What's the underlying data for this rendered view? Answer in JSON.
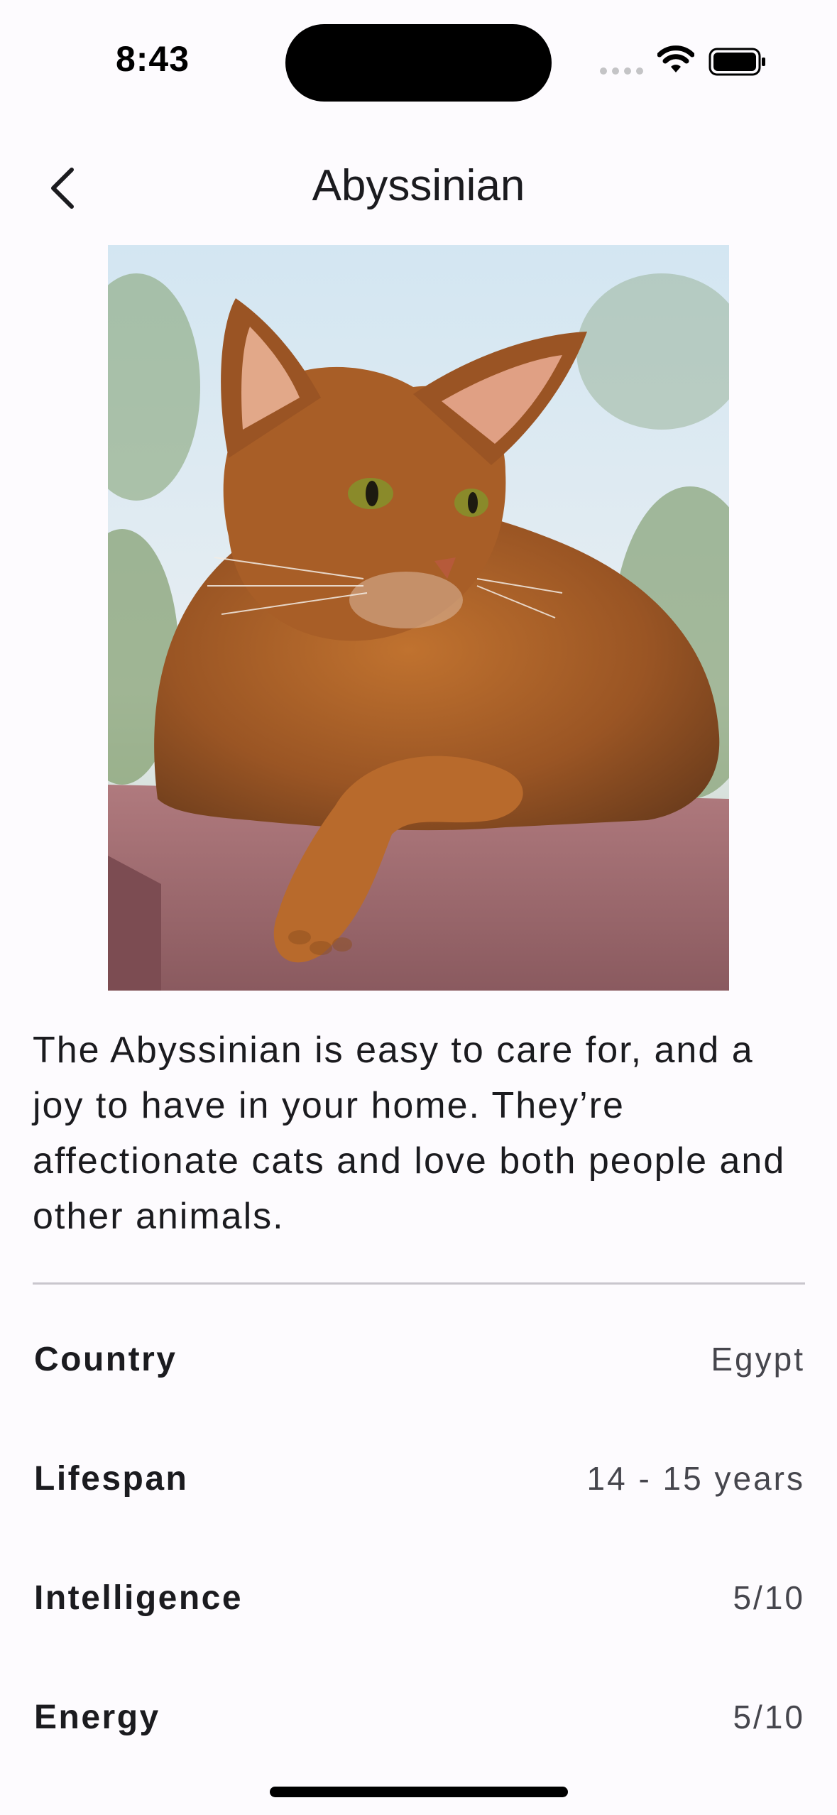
{
  "status_bar": {
    "time": "8:43"
  },
  "nav": {
    "title": "Abyssinian",
    "back_icon": "chevron-left-icon"
  },
  "breed": {
    "image_icon": "cat-photo",
    "description": "The Abyssinian is easy to care for, and a joy to have in your home. They’re affectionate cats and love both people and other animals."
  },
  "attributes": [
    {
      "label": "Country",
      "value": "Egypt"
    },
    {
      "label": "Lifespan",
      "value": "14 - 15 years"
    },
    {
      "label": "Intelligence",
      "value": "5/10"
    },
    {
      "label": "Energy",
      "value": "5/10"
    }
  ],
  "colors": {
    "background": "#fdfbfe",
    "text": "#1b1b1f",
    "secondary_text": "#46464d",
    "divider": "#c9c6cd"
  }
}
